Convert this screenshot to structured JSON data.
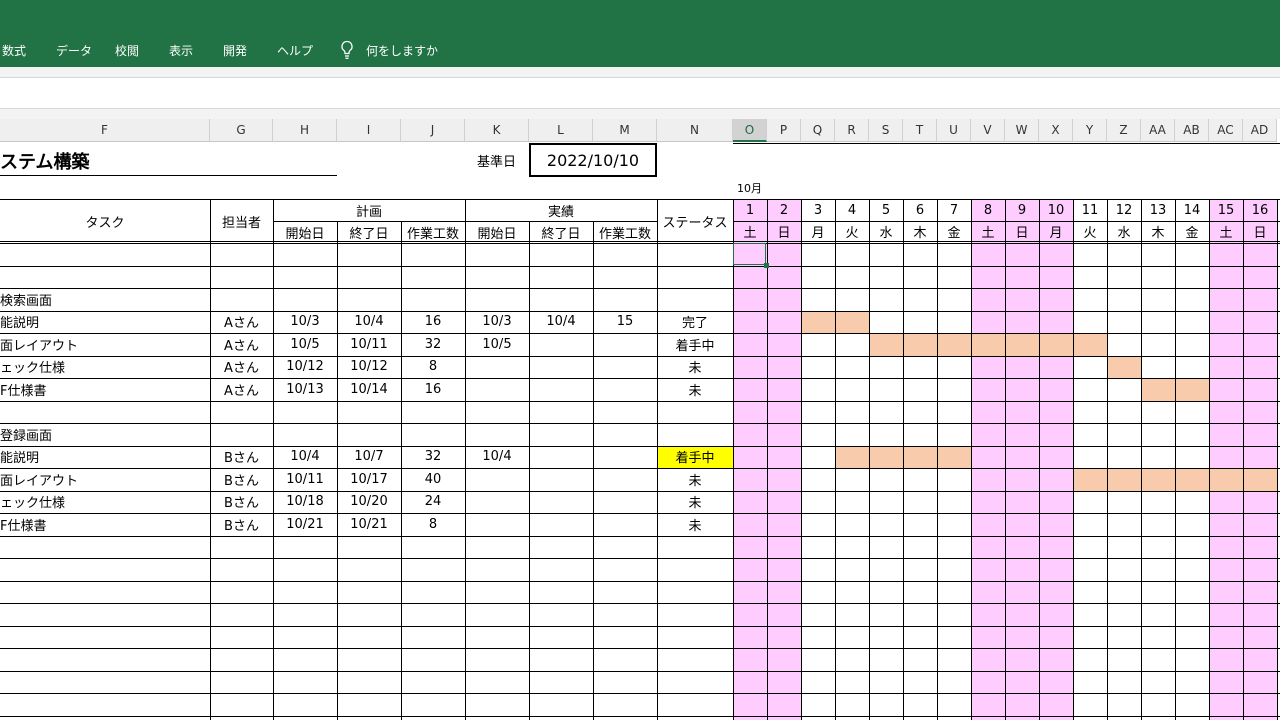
{
  "ribbon": {
    "tabs": [
      "数式",
      "データ",
      "校閲",
      "表示",
      "開発",
      "ヘルプ"
    ],
    "tell_me": "何をしますか"
  },
  "column_headers": {
    "left": [
      "F",
      "G",
      "H",
      "I",
      "J",
      "K",
      "L",
      "M",
      "N"
    ],
    "calendar": [
      "O",
      "P",
      "Q",
      "R",
      "S",
      "T",
      "U",
      "V",
      "W",
      "X",
      "Y",
      "Z",
      "AA",
      "AB",
      "AC",
      "AD"
    ]
  },
  "sheet": {
    "title": "ステム構築",
    "base_date_label": "基準日",
    "base_date": "2022/10/10",
    "month_label": "10月",
    "headers": {
      "task": "タスク",
      "assignee": "担当者",
      "plan": "計画",
      "actual": "実績",
      "status": "ステータス",
      "start": "開始日",
      "end": "終了日",
      "effort": "作業工数"
    },
    "calendar": {
      "days": [
        "1",
        "2",
        "3",
        "4",
        "5",
        "6",
        "7",
        "8",
        "9",
        "10",
        "11",
        "12",
        "13",
        "14",
        "15",
        "16"
      ],
      "weekdays": [
        "土",
        "日",
        "月",
        "火",
        "水",
        "木",
        "金",
        "土",
        "日",
        "月",
        "火",
        "水",
        "木",
        "金",
        "土",
        "日"
      ],
      "weekend_indexes": [
        0,
        1,
        7,
        8,
        9,
        14,
        15
      ],
      "weekend_color": "#ffccff",
      "bar_color": "#f8cbad",
      "highlight_color": "#ffff00"
    },
    "rows": [
      {
        "task": "",
        "assignee": "",
        "plan_start": "",
        "plan_end": "",
        "plan_effort": "",
        "actual_start": "",
        "actual_end": "",
        "actual_effort": "",
        "status": ""
      },
      {
        "task": "",
        "assignee": "",
        "plan_start": "",
        "plan_end": "",
        "plan_effort": "",
        "actual_start": "",
        "actual_end": "",
        "actual_effort": "",
        "status": ""
      },
      {
        "task": "検索画面",
        "assignee": "",
        "plan_start": "",
        "plan_end": "",
        "plan_effort": "",
        "actual_start": "",
        "actual_end": "",
        "actual_effort": "",
        "status": ""
      },
      {
        "task": "能説明",
        "assignee": "Aさん",
        "plan_start": "10/3",
        "plan_end": "10/4",
        "plan_effort": "16",
        "actual_start": "10/3",
        "actual_end": "10/4",
        "actual_effort": "15",
        "status": "完了",
        "bar": [
          2,
          3
        ]
      },
      {
        "task": "面レイアウト",
        "assignee": "Aさん",
        "plan_start": "10/5",
        "plan_end": "10/11",
        "plan_effort": "32",
        "actual_start": "10/5",
        "actual_end": "",
        "actual_effort": "",
        "status": "着手中",
        "bar": [
          4,
          10
        ]
      },
      {
        "task": "ェック仕様",
        "assignee": "Aさん",
        "plan_start": "10/12",
        "plan_end": "10/12",
        "plan_effort": "8",
        "actual_start": "",
        "actual_end": "",
        "actual_effort": "",
        "status": "未",
        "bar": [
          11,
          11
        ]
      },
      {
        "task": "F仕様書",
        "assignee": "Aさん",
        "plan_start": "10/13",
        "plan_end": "10/14",
        "plan_effort": "16",
        "actual_start": "",
        "actual_end": "",
        "actual_effort": "",
        "status": "未",
        "bar": [
          12,
          13
        ]
      },
      {
        "task": "",
        "assignee": "",
        "plan_start": "",
        "plan_end": "",
        "plan_effort": "",
        "actual_start": "",
        "actual_end": "",
        "actual_effort": "",
        "status": ""
      },
      {
        "task": "登録画面",
        "assignee": "",
        "plan_start": "",
        "plan_end": "",
        "plan_effort": "",
        "actual_start": "",
        "actual_end": "",
        "actual_effort": "",
        "status": ""
      },
      {
        "task": "能説明",
        "assignee": "Bさん",
        "plan_start": "10/4",
        "plan_end": "10/7",
        "plan_effort": "32",
        "actual_start": "10/4",
        "actual_end": "",
        "actual_effort": "",
        "status": "着手中",
        "bar": [
          3,
          6
        ],
        "status_highlight": true
      },
      {
        "task": "面レイアウト",
        "assignee": "Bさん",
        "plan_start": "10/11",
        "plan_end": "10/17",
        "plan_effort": "40",
        "actual_start": "",
        "actual_end": "",
        "actual_effort": "",
        "status": "未",
        "bar": [
          10,
          15
        ]
      },
      {
        "task": "ェック仕様",
        "assignee": "Bさん",
        "plan_start": "10/18",
        "plan_end": "10/20",
        "plan_effort": "24",
        "actual_start": "",
        "actual_end": "",
        "actual_effort": "",
        "status": "未"
      },
      {
        "task": "F仕様書",
        "assignee": "Bさん",
        "plan_start": "10/21",
        "plan_end": "10/21",
        "plan_effort": "8",
        "actual_start": "",
        "actual_end": "",
        "actual_effort": "",
        "status": "未"
      },
      {
        "task": "",
        "assignee": "",
        "plan_start": "",
        "plan_end": "",
        "plan_effort": "",
        "actual_start": "",
        "actual_end": "",
        "actual_effort": "",
        "status": ""
      },
      {
        "task": "",
        "assignee": "",
        "plan_start": "",
        "plan_end": "",
        "plan_effort": "",
        "actual_start": "",
        "actual_end": "",
        "actual_effort": "",
        "status": ""
      },
      {
        "task": "",
        "assignee": "",
        "plan_start": "",
        "plan_end": "",
        "plan_effort": "",
        "actual_start": "",
        "actual_end": "",
        "actual_effort": "",
        "status": ""
      },
      {
        "task": "",
        "assignee": "",
        "plan_start": "",
        "plan_end": "",
        "plan_effort": "",
        "actual_start": "",
        "actual_end": "",
        "actual_effort": "",
        "status": ""
      },
      {
        "task": "",
        "assignee": "",
        "plan_start": "",
        "plan_end": "",
        "plan_effort": "",
        "actual_start": "",
        "actual_end": "",
        "actual_effort": "",
        "status": ""
      },
      {
        "task": "",
        "assignee": "",
        "plan_start": "",
        "plan_end": "",
        "plan_effort": "",
        "actual_start": "",
        "actual_end": "",
        "actual_effort": "",
        "status": ""
      },
      {
        "task": "",
        "assignee": "",
        "plan_start": "",
        "plan_end": "",
        "plan_effort": "",
        "actual_start": "",
        "actual_end": "",
        "actual_effort": "",
        "status": ""
      },
      {
        "task": "",
        "assignee": "",
        "plan_start": "",
        "plan_end": "",
        "plan_effort": "",
        "actual_start": "",
        "actual_end": "",
        "actual_effort": "",
        "status": ""
      }
    ]
  }
}
